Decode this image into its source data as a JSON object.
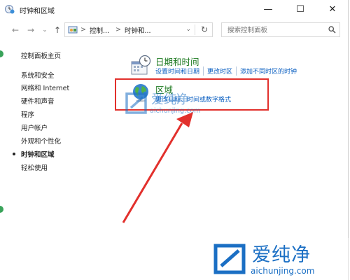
{
  "window": {
    "title": "时钟和区域"
  },
  "window_controls": {
    "minimize": "—",
    "maximize": "☐",
    "close": "✕"
  },
  "nav": {
    "back": "←",
    "forward": "→",
    "down": "⌄",
    "up": "↑"
  },
  "address": {
    "crumbs": [
      "控制...",
      "时钟和..."
    ],
    "separator": ">",
    "dropdown": "⌄",
    "refresh": "↻"
  },
  "search": {
    "placeholder": "搜索控制面板"
  },
  "sidebar": {
    "items": [
      {
        "label": "控制面板主页"
      },
      {
        "label": "系统和安全"
      },
      {
        "label": "网络和 Internet"
      },
      {
        "label": "硬件和声音"
      },
      {
        "label": "程序"
      },
      {
        "label": "用户帐户"
      },
      {
        "label": "外观和个性化"
      },
      {
        "label": "时钟和区域",
        "active": true
      },
      {
        "label": "轻松使用"
      }
    ]
  },
  "categories": [
    {
      "title": "日期和时间",
      "icon": "calendar-clock-icon",
      "links": [
        "设置时间和日期",
        "更改时区",
        "添加不同时区的时钟"
      ]
    },
    {
      "title": "区域",
      "icon": "globe-icon",
      "links": [
        "更改日期、时间或数字格式"
      ]
    }
  ],
  "watermark": {
    "brand": "爱纯净",
    "url": "aichunjing.com"
  },
  "colors": {
    "link": "#0b5fc1",
    "category_title": "#1e7a21",
    "highlight": "#e2302c",
    "watermark": "#1b6fc4"
  }
}
